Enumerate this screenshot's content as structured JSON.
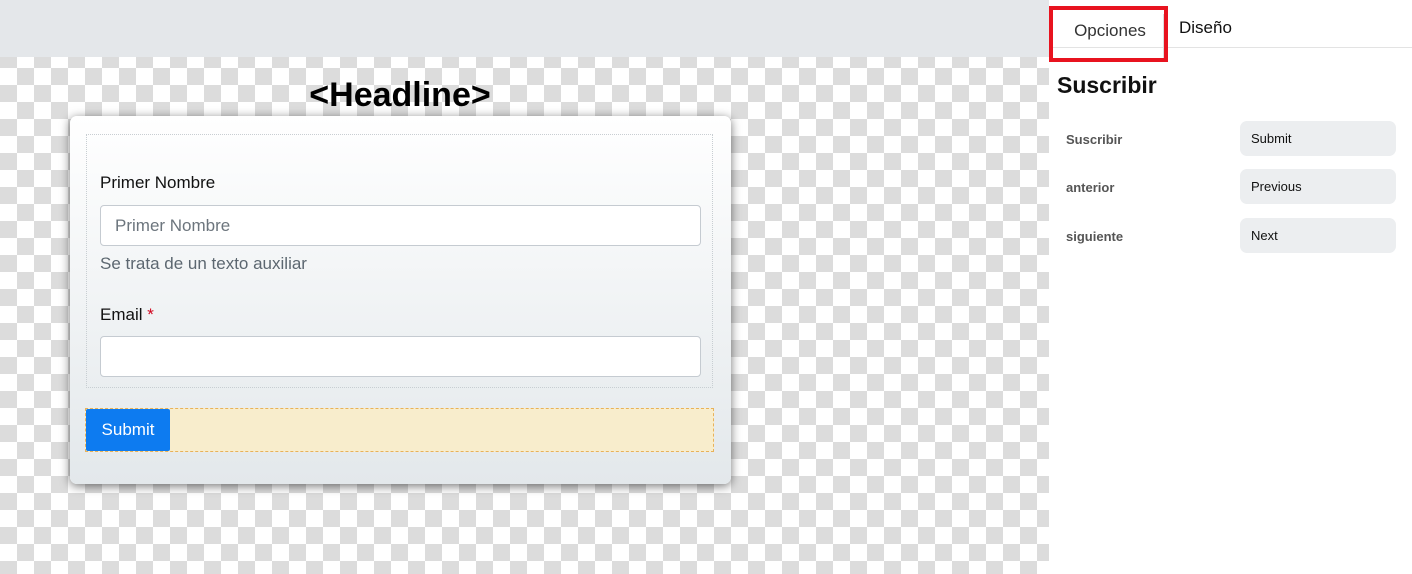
{
  "canvas": {
    "headline": "<Headline>",
    "form": {
      "first_name_label": "Primer Nombre",
      "first_name_placeholder": "Primer Nombre",
      "first_name_help": "Se trata de un texto auxiliar",
      "email_label": "Email",
      "email_required_marker": "*",
      "email_value": "",
      "submit_label": "Submit"
    }
  },
  "panel": {
    "tabs": [
      {
        "label": "Opciones",
        "active": true
      },
      {
        "label": "Diseño",
        "active": false
      }
    ],
    "title": "Suscribir",
    "properties": [
      {
        "label": "Suscribir",
        "value": "Submit"
      },
      {
        "label": "anterior",
        "value": "Previous"
      },
      {
        "label": "siguiente",
        "value": "Next"
      }
    ]
  },
  "colors": {
    "accent": "#0d7bf0",
    "highlight_border": "#e8131f",
    "required": "#d0021b"
  }
}
